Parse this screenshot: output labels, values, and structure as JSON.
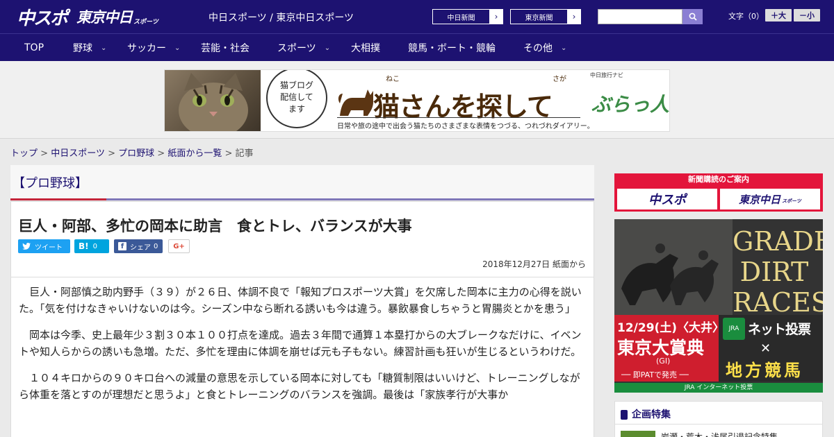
{
  "header": {
    "logo_main": "中スポ",
    "logo_sub": "東京中日",
    "logo_small": "スポーツ",
    "site_title": "中日スポーツ / 東京中日スポーツ",
    "links": [
      {
        "label": "中日新聞",
        "arrow": "›"
      },
      {
        "label": "東京新聞",
        "arrow": "›"
      }
    ],
    "search": {
      "placeholder": "",
      "icon": "search-icon"
    },
    "font_size_label": "文字（0）",
    "font_up": "＋大",
    "font_down": "－小"
  },
  "nav": {
    "items": [
      {
        "label": "TOP",
        "has_menu": false
      },
      {
        "label": "野球",
        "has_menu": true
      },
      {
        "label": "サッカー",
        "has_menu": true
      },
      {
        "label": "芸能・社会",
        "has_menu": false
      },
      {
        "label": "スポーツ",
        "has_menu": true
      },
      {
        "label": "大相撲",
        "has_menu": false
      },
      {
        "label": "競馬・ボート・競輪",
        "has_menu": false
      },
      {
        "label": "その他",
        "has_menu": true
      }
    ],
    "chevron": "⌄"
  },
  "banner": {
    "bubble": "猫ブログ\n配信して\nます",
    "title": "猫さんを探して",
    "ruby_neko": "ねこ",
    "ruby_saga": "さが",
    "subtitle": "日常や旅の途中で出会う猫たちのさまざまな表情をつづる、つれづれダイアリー。",
    "brand_small": "中日旅行ナビ",
    "brand": "ぶらっ人"
  },
  "breadcrumb": {
    "items": [
      "トップ",
      "中日スポーツ",
      "プロ野球",
      "紙面から一覧"
    ],
    "current": "記事",
    "sep": ">"
  },
  "category": "【プロ野球】",
  "article": {
    "title": "巨人・阿部、多忙の岡本に助言　食とトレ、バランスが大事",
    "share": {
      "tweet": "ツイート",
      "hatena": "B!",
      "hatena_count": "0",
      "facebook": "シェア",
      "facebook_count": "0",
      "gplus": "G+"
    },
    "date": "2018年12月27日 紙面から",
    "paragraphs": [
      "巨人・阿部慎之助内野手（３９）が２６日、体調不良で「報知プロスポーツ大賞」を欠席した岡本に主力の心得を説いた。「気を付けなきゃいけないのは今。シーズン中なら断れる誘いも今は違う。暴飲暴食しちゃうと胃腸炎とかを患う」",
      "岡本は今季、史上最年少３割３０本１００打点を達成。過去３年間で通算１本塁打からの大ブレークなだけに、イベントや知人らからの誘いも急増。ただ、多忙を理由に体調を崩せば元も子もない。練習計画も狂いが生じるというわけだ。",
      "１０４キロからの９０キロ台への減量の意思を示している岡本に対しても「糖質制限はいいけど、トレーニングしながら体重を落とすのが理想だと思うよ」と食とトレーニングのバランスを強調。最後は「家族孝行が大事か"
    ]
  },
  "sidebar": {
    "subscribe": {
      "heading": "新聞購読のご案内",
      "b1": "中スポ",
      "b2": "東京中日",
      "b2_small": "スポーツ"
    },
    "jra_ad": {
      "headline": "GRADED DIRT RACES",
      "date": "12/29(土)〈大井〉",
      "race": "東京大賞典",
      "grade": "(GI)",
      "pat": "── 即PATで発売 ──",
      "jra": "JRA",
      "net": "ネット投票",
      "chiho": "地方競馬",
      "footer": "JRA インターネット投票"
    },
    "feature": {
      "heading": "企画特集",
      "item": "岩瀬・荒木・浅尾引退記念特集"
    }
  },
  "colors": {
    "brand": "#1d1271",
    "accent_red": "#c4253a",
    "purple": "#7f77b8",
    "twitter": "#1da1f2",
    "hatena": "#00a4de",
    "facebook": "#3b5998"
  }
}
